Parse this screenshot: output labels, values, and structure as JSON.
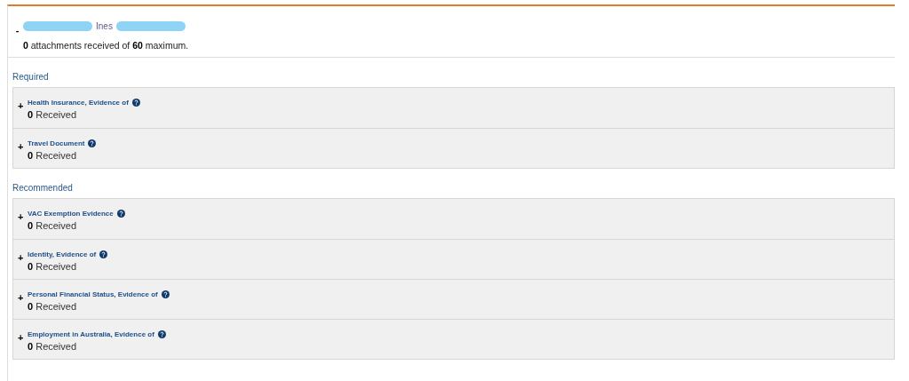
{
  "applicant": {
    "toggle": "-",
    "name_parts": [
      {
        "kind": "redacted"
      },
      {
        "kind": "text",
        "text": "Ines"
      },
      {
        "kind": "redacted"
      }
    ],
    "summary": "**0** attachments received of **60** maximum."
  },
  "sections": [
    {
      "heading": "Required",
      "items": [
        {
          "toggle": "+",
          "title": "Health Insurance, Evidence of",
          "status": "**0** Received"
        },
        {
          "toggle": "+",
          "title": "Travel Document",
          "status": "**0** Received"
        }
      ]
    },
    {
      "heading": "Recommended",
      "items": [
        {
          "toggle": "+",
          "title": "VAC Exemption Evidence",
          "status": "**0** Received"
        },
        {
          "toggle": "+",
          "title": "Identity, Evidence of",
          "status": "**0** Received"
        },
        {
          "toggle": "+",
          "title": "Personal Financial Status, Evidence of",
          "status": "**0** Received"
        },
        {
          "toggle": "+",
          "title": "Employment in Australia, Evidence of",
          "status": "**0** Received"
        }
      ]
    }
  ]
}
